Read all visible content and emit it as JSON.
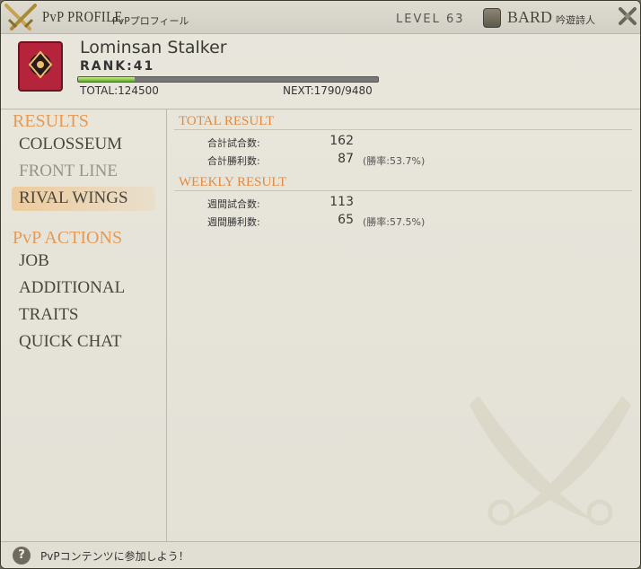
{
  "window": {
    "title": "PvP PROFILE",
    "title_jp": "PvPプロフィール",
    "level": "LEVEL 63",
    "job": "BARD",
    "job_jp": "吟遊詩人"
  },
  "profile": {
    "name": "Lominsan Stalker",
    "rank": "RANK:41",
    "rank_progress": 0.19,
    "total": "TOTAL:124500",
    "next": "NEXT:1790/9480"
  },
  "sidebar": {
    "results_title": "RESULTS",
    "results_items": [
      {
        "label": "COLOSSEUM",
        "enabled": true
      },
      {
        "label": "FRONT LINE",
        "enabled": false
      },
      {
        "label": "RIVAL WINGS",
        "enabled": true,
        "selected": true
      }
    ],
    "actions_title": "PvP ACTIONS",
    "actions_items": [
      {
        "label": "JOB"
      },
      {
        "label": "ADDITIONAL"
      },
      {
        "label": "TRAITS"
      },
      {
        "label": "QUICK CHAT"
      }
    ]
  },
  "results": {
    "total": {
      "title": "TOTAL RESULT",
      "matches_label": "合計試合数:",
      "matches_value": "162",
      "wins_label": "合計勝利数:",
      "wins_value": "87",
      "wins_pct": "(勝率:53.7%)"
    },
    "weekly": {
      "title": "WEEKLY RESULT",
      "matches_label": "週間試合数:",
      "matches_value": "113",
      "wins_label": "週間勝利数:",
      "wins_value": "65",
      "wins_pct": "(勝率:57.5%)"
    }
  },
  "status": {
    "text": "PvPコンテンツに参加しよう！",
    "help_icon": "?"
  },
  "colors": {
    "accent": "#e59a55",
    "rank_bar": "#7cc13a"
  },
  "icons": [
    "crossed-swords-icon",
    "job-icon",
    "close-icon",
    "emblem-icon",
    "help-icon",
    "crossed-swords-watermark-icon"
  ]
}
